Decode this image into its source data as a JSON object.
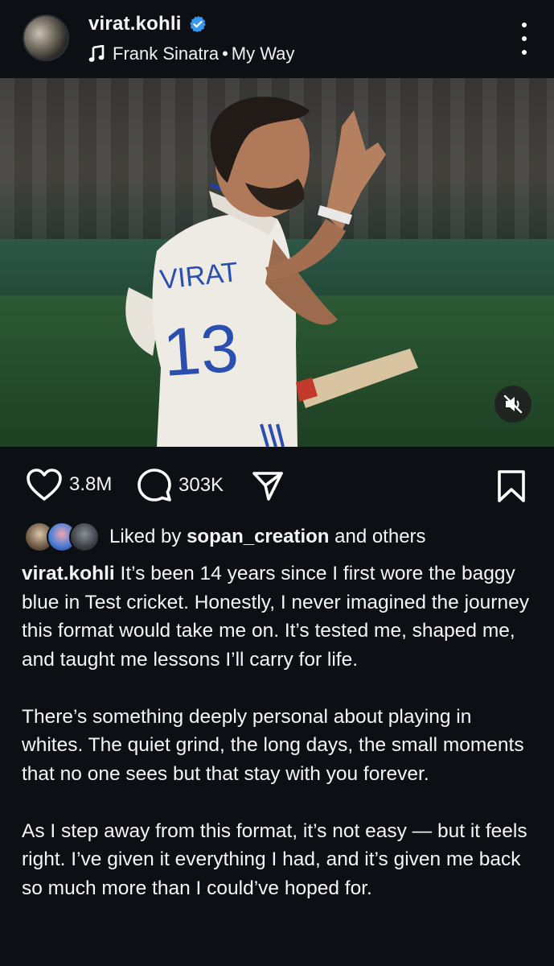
{
  "post_header": {
    "username": "virat.kohli",
    "song_artist": "Frank Sinatra",
    "song_separator": "•",
    "song_title": "My Way"
  },
  "media": {
    "mute_icon": "volume-off-icon"
  },
  "actions": {
    "likes_count": "3.8M",
    "comments_count": "303K",
    "icons": [
      "heart-icon",
      "comment-icon",
      "send-icon",
      "bookmark-icon"
    ]
  },
  "liked_by": {
    "prefix": "Liked by",
    "user": "sopan_creation",
    "suffix": "and others"
  },
  "caption": {
    "username": "virat.kohli",
    "paragraph1": "It’s been 14 years since I first wore the baggy blue in Test cricket. Honestly, I never imagined the journey this format would take me on. It’s tested me, shaped me, and taught me lessons I’ll carry for life.",
    "paragraph2": "There’s something deeply personal about playing in whites. The quiet grind, the long days, the small moments that no one sees but that stay with you forever.",
    "paragraph3": "As I step away from this format, it’s not easy — but it feels right. I’ve given it everything I had, and it’s given me back so much more than I could’ve hoped for."
  },
  "colors": {
    "background": "#0c1014",
    "text": "#f5f5f5",
    "verified_blue": "#3897f0"
  }
}
